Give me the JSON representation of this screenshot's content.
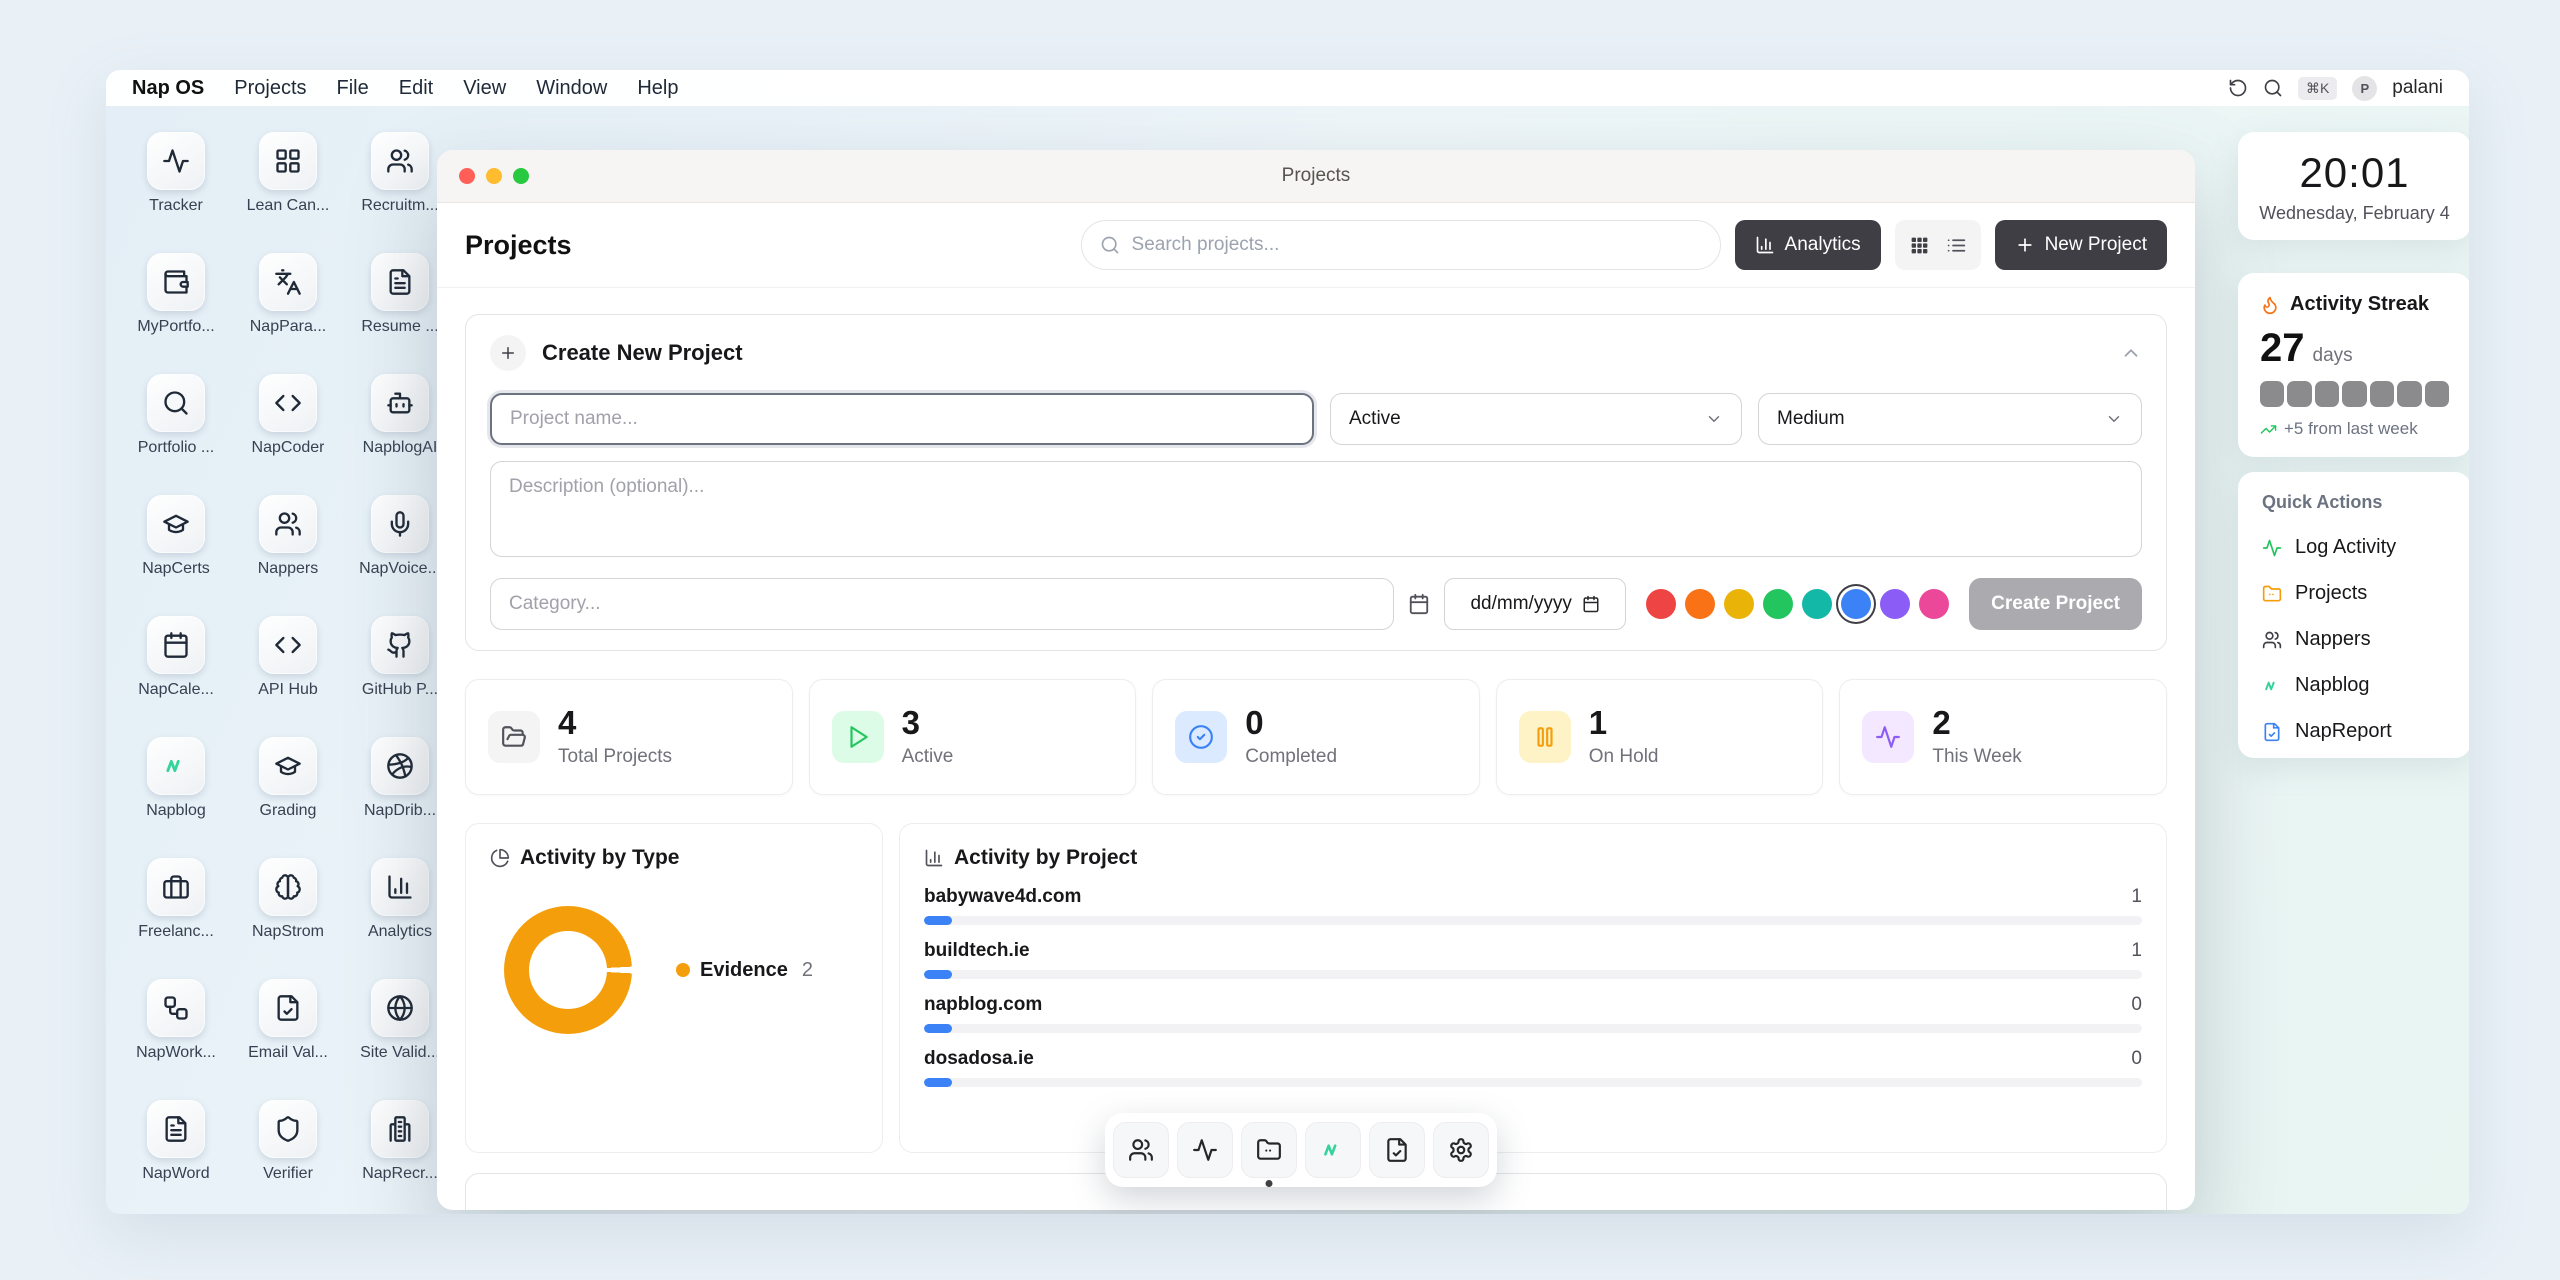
{
  "menu_bar": {
    "brand": "Nap OS",
    "items": [
      "Projects",
      "File",
      "Edit",
      "View",
      "Window",
      "Help"
    ],
    "right": {
      "shortcut": "⌘K",
      "avatar_initial": "P",
      "username": "palani"
    }
  },
  "desktop_icons": [
    {
      "label": "Tracker",
      "icon": "activity"
    },
    {
      "label": "Lean Can...",
      "icon": "layout-grid"
    },
    {
      "label": "Recruitm...",
      "icon": "users"
    },
    {
      "label": "MyPortfo...",
      "icon": "wallet"
    },
    {
      "label": "NapPara...",
      "icon": "languages"
    },
    {
      "label": "Resume ...",
      "icon": "file-text"
    },
    {
      "label": "Portfolio ...",
      "icon": "search"
    },
    {
      "label": "NapCoder",
      "icon": "code"
    },
    {
      "label": "NapblogAI",
      "icon": "bot"
    },
    {
      "label": "NapCerts",
      "icon": "graduation-cap"
    },
    {
      "label": "Nappers",
      "icon": "users"
    },
    {
      "label": "NapVoice...",
      "icon": "mic"
    },
    {
      "label": "NapCale...",
      "icon": "calendar"
    },
    {
      "label": "API Hub",
      "icon": "code"
    },
    {
      "label": "GitHub P...",
      "icon": "github"
    },
    {
      "label": "Napblog",
      "icon": "napblog",
      "color": "#34d399"
    },
    {
      "label": "Grading",
      "icon": "graduation-cap"
    },
    {
      "label": "NapDrib...",
      "icon": "dribbble"
    },
    {
      "label": "Freelanc...",
      "icon": "briefcase"
    },
    {
      "label": "NapStrom",
      "icon": "brain"
    },
    {
      "label": "Analytics",
      "icon": "bar-chart"
    },
    {
      "label": "NapWork...",
      "icon": "workflow"
    },
    {
      "label": "Email Val...",
      "icon": "file-check"
    },
    {
      "label": "Site Valid...",
      "icon": "globe"
    },
    {
      "label": "NapWord",
      "icon": "file-text"
    },
    {
      "label": "Verifier",
      "icon": "shield"
    },
    {
      "label": "NapRecr...",
      "icon": "building"
    }
  ],
  "window": {
    "titlebar": {
      "title": "Projects"
    },
    "header": {
      "title": "Projects",
      "search_placeholder": "Search projects...",
      "analytics_label": "Analytics",
      "new_project_label": "New Project"
    },
    "create_form": {
      "title": "Create New Project",
      "name_placeholder": "Project name...",
      "status_value": "Active",
      "priority_value": "Medium",
      "description_placeholder": "Description (optional)...",
      "category_placeholder": "Category...",
      "date_placeholder": "dd/mm/yyyy",
      "colors": [
        "#ef4444",
        "#f97316",
        "#eab308",
        "#22c55e",
        "#14b8a6",
        "#3b82f6",
        "#8b5cf6",
        "#ec4899"
      ],
      "selected_color_index": 5,
      "submit_label": "Create Project"
    },
    "stats": [
      {
        "value": "4",
        "label": "Total Projects",
        "icon": "folder-open",
        "fg": "#52525b",
        "bg": "#f4f4f5"
      },
      {
        "value": "3",
        "label": "Active",
        "icon": "play",
        "fg": "#22c55e",
        "bg": "#dcfce7"
      },
      {
        "value": "0",
        "label": "Completed",
        "icon": "circle-check",
        "fg": "#3b82f6",
        "bg": "#dbeafe"
      },
      {
        "value": "1",
        "label": "On Hold",
        "icon": "pause",
        "fg": "#f59e0b",
        "bg": "#fef3c7"
      },
      {
        "value": "2",
        "label": "This Week",
        "icon": "activity",
        "fg": "#8b5cf6",
        "bg": "#f3e8ff"
      }
    ],
    "activity_by_type": {
      "title": "Activity by Type",
      "legend": [
        {
          "label": "Evidence",
          "value": 2,
          "color": "#f59e0b"
        }
      ]
    },
    "activity_by_project": {
      "title": "Activity by Project",
      "bar_color": "#3b82f6",
      "rows": [
        {
          "name": "babywave4d.com",
          "value": 1
        },
        {
          "name": "buildtech.ie",
          "value": 1
        },
        {
          "name": "napblog.com",
          "value": 0
        },
        {
          "name": "dosadosa.ie",
          "value": 0
        }
      ]
    }
  },
  "chart_data": [
    {
      "type": "pie",
      "donut": true,
      "title": "Activity by Type",
      "labels": [
        "Evidence"
      ],
      "values": [
        2
      ],
      "colors": [
        "#f59e0b"
      ],
      "legend_position": "right"
    },
    {
      "type": "bar",
      "orientation": "horizontal",
      "title": "Activity by Project",
      "categories": [
        "babywave4d.com",
        "buildtech.ie",
        "napblog.com",
        "dosadosa.ie"
      ],
      "values": [
        1,
        1,
        0,
        0
      ],
      "bar_color": "#3b82f6"
    }
  ],
  "dock": {
    "items": [
      {
        "name": "nappers",
        "icon": "users"
      },
      {
        "name": "tracker",
        "icon": "activity"
      },
      {
        "name": "projects",
        "icon": "folder",
        "active": true
      },
      {
        "name": "napblog",
        "icon": "napblog",
        "color": "#34d399"
      },
      {
        "name": "reports",
        "icon": "file-check"
      },
      {
        "name": "settings",
        "icon": "settings"
      }
    ]
  },
  "widgets": {
    "clock": {
      "time": "20:01",
      "date": "Wednesday, February 4"
    },
    "streak": {
      "title": "Activity Streak",
      "value": "27",
      "unit": "days",
      "blocks": 7,
      "delta": "+5 from last week"
    },
    "quick_actions": {
      "title": "Quick Actions",
      "items": [
        {
          "label": "Log Activity",
          "icon": "activity",
          "color": "#22c55e"
        },
        {
          "label": "Projects",
          "icon": "folder",
          "color": "#f59e0b"
        },
        {
          "label": "Nappers",
          "icon": "users",
          "color": "#3f3f46"
        },
        {
          "label": "Napblog",
          "icon": "napblog",
          "color": "#34d399"
        },
        {
          "label": "NapReport",
          "icon": "file-check",
          "color": "#3b82f6"
        }
      ]
    }
  }
}
